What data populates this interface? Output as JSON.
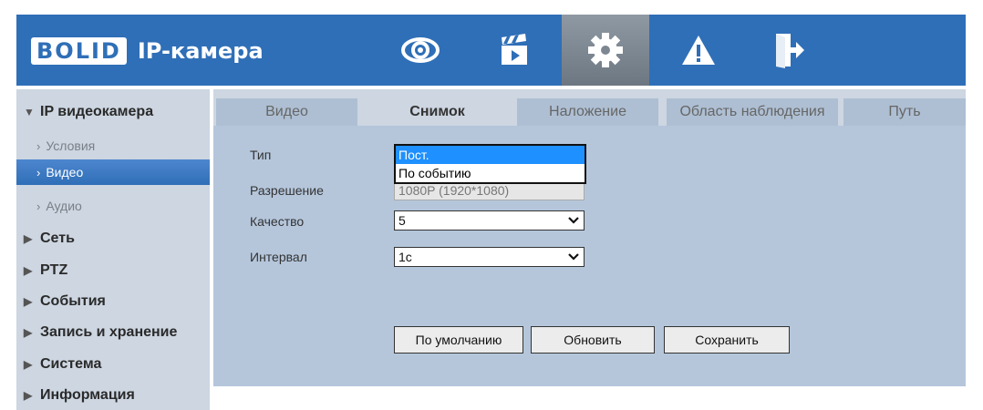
{
  "header": {
    "logo_brand": "BOLID",
    "logo_text": "IP-камера",
    "nav": [
      {
        "icon": "eye-icon",
        "name": "live-view"
      },
      {
        "icon": "clapperboard-icon",
        "name": "playback"
      },
      {
        "icon": "gear-icon",
        "name": "settings",
        "active": true
      },
      {
        "icon": "warning-icon",
        "name": "alarm"
      },
      {
        "icon": "exit-icon",
        "name": "logout"
      }
    ],
    "colors": {
      "bar": "#2f6fb7",
      "active": "#7d8791"
    }
  },
  "sidebar": {
    "items": [
      {
        "label": "IP видеокамера",
        "expanded": true
      },
      {
        "label": "Условия"
      },
      {
        "label": "Видео",
        "active": true
      },
      {
        "label": "Аудио"
      },
      {
        "label": "Сеть"
      },
      {
        "label": "PTZ"
      },
      {
        "label": "События"
      },
      {
        "label": "Запись и хранение"
      },
      {
        "label": "Система"
      },
      {
        "label": "Информация"
      }
    ]
  },
  "tabs": [
    {
      "label": "Видео"
    },
    {
      "label": "Снимок",
      "active": true
    },
    {
      "label": "Наложение"
    },
    {
      "label": "Область наблюдения"
    },
    {
      "label": "Путь"
    }
  ],
  "form": {
    "type_label": "Тип",
    "type_options": [
      "Пост.",
      "По событию"
    ],
    "type_selected": "Пост.",
    "resolution_label": "Разрешение",
    "resolution_value": "1080P (1920*1080)",
    "quality_label": "Качество",
    "quality_value": "5",
    "interval_label": "Интервал",
    "interval_value": "1с"
  },
  "buttons": {
    "default": "По умолчанию",
    "refresh": "Обновить",
    "save": "Сохранить"
  }
}
